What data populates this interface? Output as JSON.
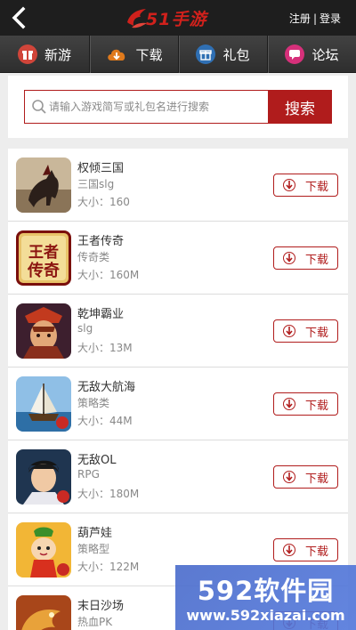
{
  "header": {
    "logo_text": "51手游",
    "register": "注册",
    "separator": "|",
    "login": "登录"
  },
  "nav": [
    {
      "label": "新游",
      "icon": "gift-box-icon",
      "color": "#d0453a"
    },
    {
      "label": "下载",
      "icon": "cloud-download-icon",
      "color": "#e07a1c"
    },
    {
      "label": "礼包",
      "icon": "gift-icon",
      "color": "#2f6fb3"
    },
    {
      "label": "论坛",
      "icon": "chat-bubble-icon",
      "color": "#d6307a"
    }
  ],
  "search": {
    "placeholder": "请输入游戏简写或礼包名进行搜索",
    "button": "搜索"
  },
  "games": [
    {
      "name": "权倾三国",
      "category": "三国slg",
      "size": "大小：160",
      "download": "下载"
    },
    {
      "name": "王者传奇",
      "category": "传奇类",
      "size": "大小：160M",
      "download": "下载"
    },
    {
      "name": "乾坤霸业",
      "category": "slg",
      "size": "大小：13M",
      "download": "下载"
    },
    {
      "name": "无敌大航海",
      "category": "策略类",
      "size": "大小：44M",
      "download": "下载"
    },
    {
      "name": "无敌OL",
      "category": "RPG",
      "size": "大小：180M",
      "download": "下载"
    },
    {
      "name": "葫芦娃",
      "category": "策略型",
      "size": "大小：122M",
      "download": "下载"
    },
    {
      "name": "末日沙场",
      "category": "热血PK",
      "size": "",
      "download": "下载"
    }
  ],
  "watermark": {
    "top": "592软件园",
    "bottom": "www.592xiazai.com"
  },
  "colors": {
    "accent": "#b01c1c",
    "topbar": "#1e1e1e",
    "nav": "#3a3a3a"
  }
}
